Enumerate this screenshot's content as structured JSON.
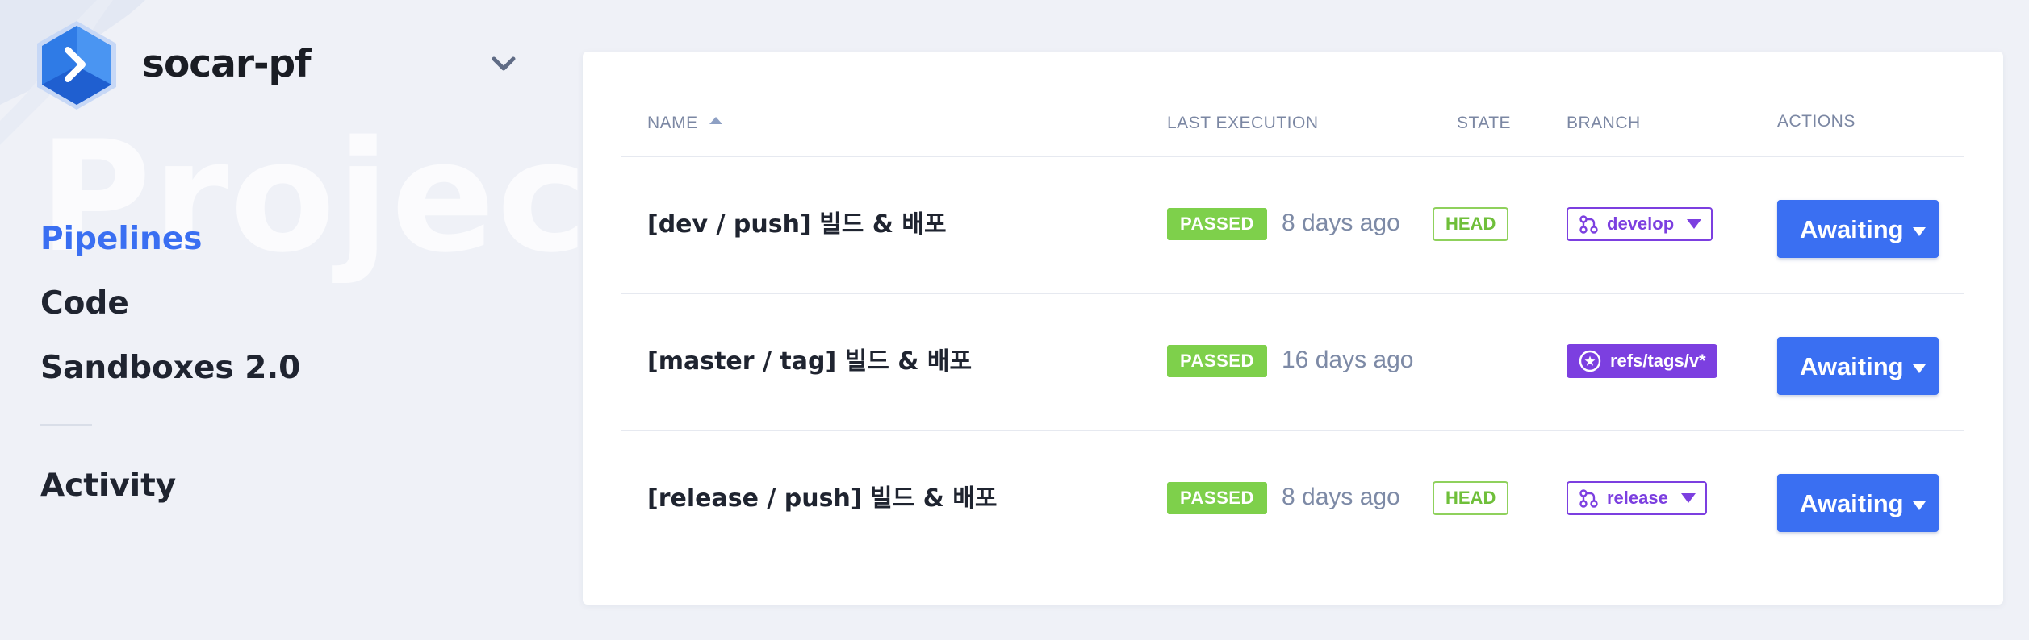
{
  "project": {
    "name": "socar-pf",
    "watermark": "Project"
  },
  "nav": {
    "items": [
      {
        "label": "Pipelines",
        "active": true
      },
      {
        "label": "Code",
        "active": false
      },
      {
        "label": "Sandboxes 2.0",
        "active": false
      },
      {
        "label": "Activity",
        "active": false
      }
    ]
  },
  "table": {
    "headers": {
      "name": "NAME",
      "last_execution": "LAST EXECUTION",
      "state": "STATE",
      "branch": "BRANCH",
      "actions": "ACTIONS"
    },
    "rows": [
      {
        "name": "[dev / push] 빌드 & 배포",
        "status": "PASSED",
        "ago": "8 days ago",
        "state": "HEAD",
        "branch": "develop",
        "branch_type": "branch",
        "action": "Awaiting"
      },
      {
        "name": "[master / tag] 빌드 & 배포",
        "status": "PASSED",
        "ago": "16 days ago",
        "state": "",
        "branch": "refs/tags/v*",
        "branch_type": "tag",
        "action": "Awaiting"
      },
      {
        "name": "[release / push] 빌드 & 배포",
        "status": "PASSED",
        "ago": "8 days ago",
        "state": "HEAD",
        "branch": "release",
        "branch_type": "branch",
        "action": "Awaiting"
      }
    ]
  },
  "colors": {
    "accent": "#3a6ff2",
    "passed": "#7ed04b",
    "head": "#8fd15c",
    "branch": "#7c3fe0"
  },
  "icons": {
    "logo": "buddy-logo-hexagon",
    "project_dropdown": "chevron-down-icon",
    "branch": "git-branch-icon",
    "tag": "tag-star-icon",
    "sort": "sort-asc-icon",
    "action_dropdown": "caret-down-icon"
  }
}
